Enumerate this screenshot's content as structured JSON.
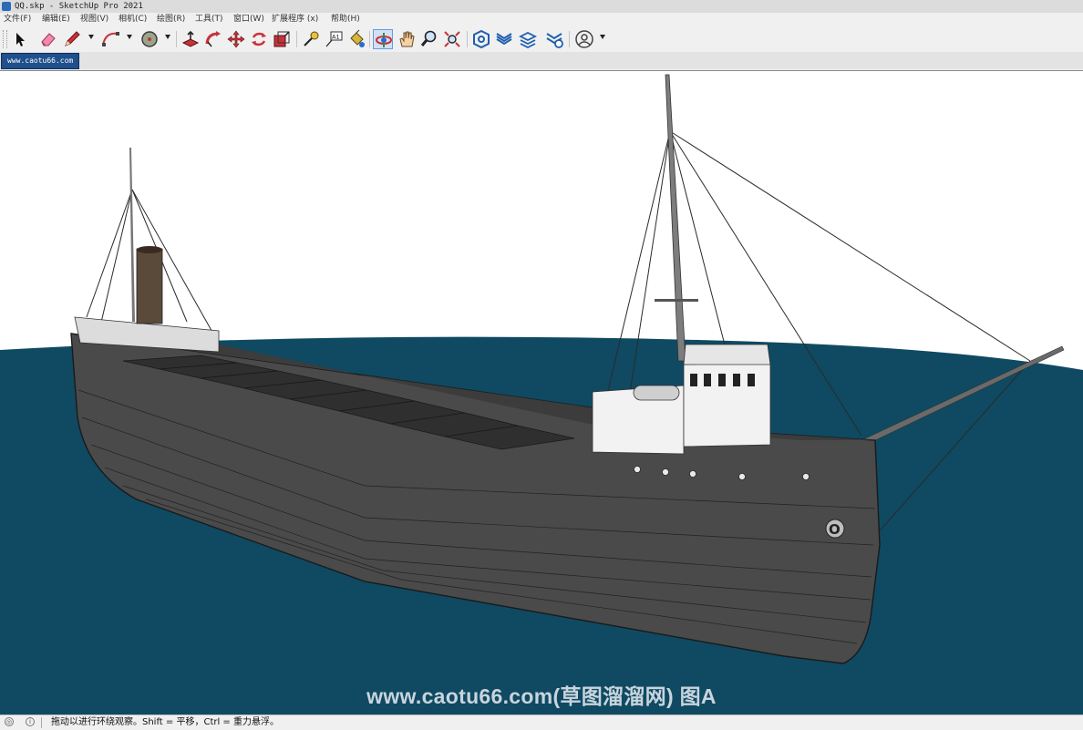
{
  "window": {
    "title": "QQ.skp - SketchUp Pro 2021"
  },
  "menu": {
    "items": [
      "文件(F)",
      "编辑(E)",
      "视图(V)",
      "相机(C)",
      "绘图(R)",
      "工具(T)",
      "窗口(W)",
      "扩展程序 (x)",
      "帮助(H)"
    ]
  },
  "toolbar": {
    "tools": [
      {
        "name": "select-tool",
        "icon": "arrow-cursor-icon"
      },
      {
        "name": "eraser-tool",
        "icon": "eraser-icon"
      },
      {
        "name": "line-tool",
        "icon": "pencil-icon"
      },
      {
        "name": "arc-tool",
        "icon": "arc-icon"
      },
      {
        "name": "shape-tool",
        "icon": "circle-icon"
      },
      {
        "name": "push-pull-tool",
        "icon": "push-pull-icon"
      },
      {
        "name": "follow-me-tool",
        "icon": "follow-me-icon"
      },
      {
        "name": "move-tool",
        "icon": "move-arrows-icon"
      },
      {
        "name": "rotate-tool",
        "icon": "rotate-icon"
      },
      {
        "name": "scale-tool",
        "icon": "scale-icon"
      },
      {
        "name": "tape-measure-tool",
        "icon": "tape-measure-icon"
      },
      {
        "name": "text-tool",
        "icon": "text-label-icon",
        "label": "A1"
      },
      {
        "name": "paint-bucket-tool",
        "icon": "paint-bucket-icon"
      },
      {
        "name": "orbit-tool",
        "icon": "orbit-icon",
        "active": true
      },
      {
        "name": "pan-tool",
        "icon": "hand-icon"
      },
      {
        "name": "zoom-tool",
        "icon": "magnifier-icon"
      },
      {
        "name": "zoom-extents-tool",
        "icon": "zoom-extents-icon"
      },
      {
        "name": "warehouse-tool",
        "icon": "3d-warehouse-icon"
      },
      {
        "name": "extension-warehouse-tool",
        "icon": "extension-warehouse-icon"
      },
      {
        "name": "layout-tool",
        "icon": "layout-icon"
      },
      {
        "name": "extension-manager-tool",
        "icon": "extension-manager-icon"
      },
      {
        "name": "account-tool",
        "icon": "user-account-icon"
      }
    ]
  },
  "scenes": {
    "tabs": [
      "www.caotu66.com"
    ]
  },
  "viewport": {
    "watermark": "www.caotu66.com(草图溜溜网) 图A",
    "hull_mark": "O",
    "colors": {
      "water": "#0f4a62",
      "hull": "#4a4a4a",
      "cabin": "#f2f2f2",
      "sky": "#ffffff"
    }
  },
  "status": {
    "message": "拖动以进行环绕观察。Shift = 平移，Ctrl = 重力悬浮。"
  }
}
